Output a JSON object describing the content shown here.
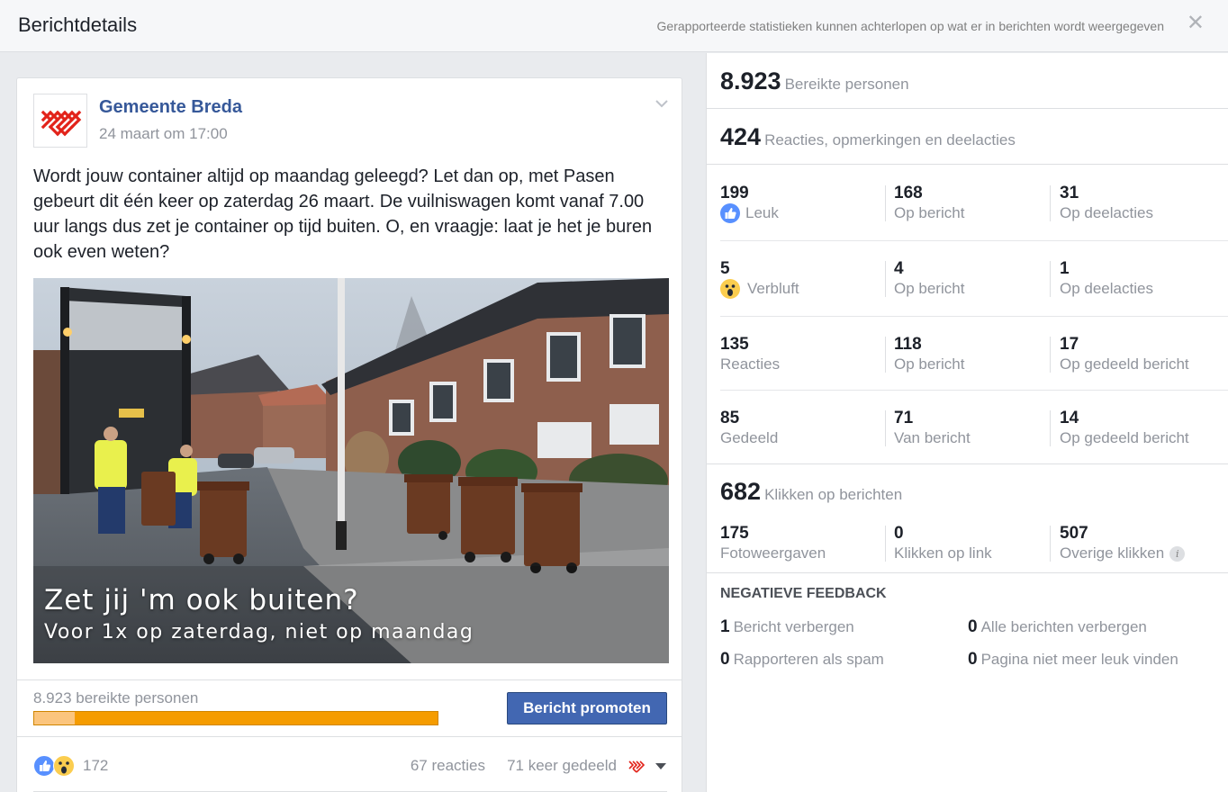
{
  "header": {
    "title": "Berichtdetails",
    "note": "Gerapporteerde statistieken kunnen achterlopen op wat er in berichten wordt weergegeven",
    "close_icon": "close-icon"
  },
  "post": {
    "page_name": "Gemeente Breda",
    "date": "24 maart om 17:00",
    "text": "Wordt jouw container altijd op maandag geleegd? Let dan op, met Pasen gebeurt dit één keer op zaterdag 26 maart. De vuilniswagen komt vanaf 7.00 uur langs dus zet je container op tijd buiten. O, en vraagje: laat je het je buren ook even weten?",
    "image_caption_line1": "Zet jij 'm ook buiten?",
    "image_caption_line2": "Voor 1x op zaterdag, niet op maandag",
    "reach_label": "8.923 bereikte personen",
    "reach_organic_fraction": 0.1,
    "promote_label": "Bericht promoten",
    "reactions_count": "172",
    "comments_count": "67 reacties",
    "shares_count": "71 keer gedeeld",
    "colors": {
      "link": "#365899",
      "reach_bar": "#f59c00",
      "reach_bar_organic": "#fbc57d",
      "button": "#4267b2",
      "brand_red": "#e2231a"
    }
  },
  "stats": {
    "reach_value": "8.923",
    "reach_label": "Bereikte personen",
    "engagement_value": "424",
    "engagement_label": "Reacties, opmerkingen en deelacties",
    "rows": [
      {
        "a_num": "199",
        "a_label": "Leuk",
        "b_num": "168",
        "b_label": "Op bericht",
        "c_num": "31",
        "c_label": "Op deelacties"
      },
      {
        "a_num": "5",
        "a_label": "Verbluft",
        "b_num": "4",
        "b_label": "Op bericht",
        "c_num": "1",
        "c_label": "Op deelacties"
      },
      {
        "a_num": "135",
        "a_label": "Reacties",
        "b_num": "118",
        "b_label": "Op bericht",
        "c_num": "17",
        "c_label": "Op gedeeld bericht"
      },
      {
        "a_num": "85",
        "a_label": "Gedeeld",
        "b_num": "71",
        "b_label": "Van bericht",
        "c_num": "14",
        "c_label": "Op gedeeld bericht"
      }
    ],
    "clicks_value": "682",
    "clicks_label": "Klikken op berichten",
    "clicks": {
      "a_num": "175",
      "a_label": "Fotoweergaven",
      "b_num": "0",
      "b_label": "Klikken op link",
      "c_num": "507",
      "c_label": "Overige klikken"
    },
    "negative": {
      "title": "NEGATIEVE FEEDBACK",
      "items": [
        {
          "num": "1",
          "label": "Bericht verbergen"
        },
        {
          "num": "0",
          "label": "Alle berichten verbergen"
        },
        {
          "num": "0",
          "label": "Rapporteren als spam"
        },
        {
          "num": "0",
          "label": "Pagina niet meer leuk vinden"
        }
      ]
    }
  }
}
